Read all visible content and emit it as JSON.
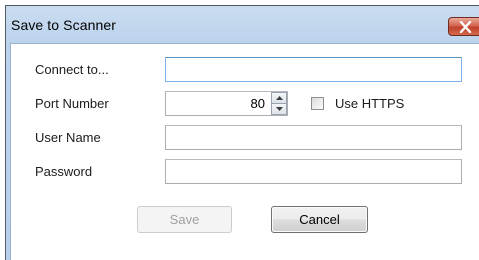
{
  "window": {
    "title": "Save to Scanner",
    "close_label": "X"
  },
  "form": {
    "connect_label": "Connect to...",
    "connect_value": "",
    "port_label": "Port Number",
    "port_value": "80",
    "https_label": "Use HTTPS",
    "https_checked": false,
    "username_label": "User Name",
    "username_value": "",
    "password_label": "Password",
    "password_value": ""
  },
  "buttons": {
    "save_label": "Save",
    "save_enabled": false,
    "cancel_label": "Cancel"
  },
  "colors": {
    "titlebar": "#c9dcf0",
    "close_button": "#c0412c",
    "focus_border": "#7eb4ea"
  }
}
